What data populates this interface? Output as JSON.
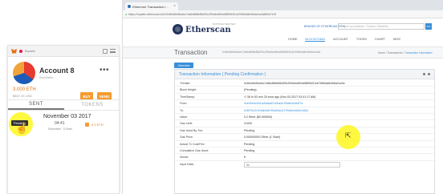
{
  "metamask": {
    "network": "Ropsten",
    "account_name": "Account 8",
    "account_address": "0xe00e0c...",
    "menu_dots": "•••",
    "balance_eth": "3.000 ETH",
    "balance_usd": "$867.03 USD",
    "buy_label": "BUY",
    "send_label": "SEND",
    "tabs": [
      {
        "label": "SENT",
        "active": true
      },
      {
        "label": "TOKENS",
        "active": false
      }
    ],
    "tx": {
      "date": "November 03 2017",
      "time": "04:41",
      "status": "Submitted · 5 Gwei",
      "amount": "0.2 ETH",
      "tooltip": "Pending"
    }
  },
  "browser": {
    "tab_title": "Ethereum Transaction I...",
    "address": "https://ropsten.etherscan.io/tx/0x5b3d0d9a4ec7a6bd66fe85d29c2f9c6ea9b4d58f0fe01cb7bf60a8e0b6a2cc0a8b0e7e3f",
    "secure_label": "Secure"
  },
  "etherscan": {
    "brand": "Etherscan",
    "brand_sub": "ROPSTEN TESTNET",
    "promo": "BRANDS OF ETHEREUM (ETH)",
    "search_placeholder": "Search by Address / Txhash / BlockNo",
    "search_go": "GO",
    "nav": [
      {
        "label": "HOME",
        "active": false
      },
      {
        "label": "BLOCKCHAIN",
        "active": true
      },
      {
        "label": "ACCOUNT",
        "active": false
      },
      {
        "label": "TOKEN",
        "active": false
      },
      {
        "label": "CHART",
        "active": false
      },
      {
        "label": "MISC",
        "active": false
      }
    ],
    "page_title": "Transaction",
    "page_hash": "0x5b3d0d9a4ec7a6bd66fe85d29c2f9c6ea9b4d58f0fe01cb7bf60a8e0b6a2cc0a",
    "breadcrumb": [
      "Home",
      "Transactions",
      "Transaction Information"
    ],
    "overview_tab": "Overview",
    "panel_title": "Transaction Information   ( Pending Confirmation )",
    "rows": [
      {
        "label": "TxHash:",
        "value": "0x5b3d0d9a4ec7a6bd66fe85d29c2f9c6ea9b4d58f0fe01cb7bf60a8e0b6a2cc0a",
        "link": false
      },
      {
        "label": "Block Height:",
        "value": "(Pending)",
        "link": false
      },
      {
        "label": "TimeStamp:",
        "value": "⏱ 38 hr 53 min 25 secs ago (Nov-03-2017 03:41:17 AM)",
        "link": false
      },
      {
        "label": "From:",
        "value": "0xe00e0c0b1ad3a6a67c0ba3e7f5a6c54d4f7a",
        "link": true
      },
      {
        "label": "To:",
        "value": "0x6f79c2c7b3ab4db7fba54ac317f0a5ce6d0c4d0d",
        "link": true
      },
      {
        "label": "Value:",
        "value": "0.2 Ether ($0.000000)",
        "link": false
      },
      {
        "label": "Gas Limit:",
        "value": "21000",
        "link": false
      },
      {
        "label": "Gas Used By Txn:",
        "value": "Pending",
        "link": false
      },
      {
        "label": "Gas Price:",
        "value": "0.000000001 Ether (1 Gwei)",
        "link": false
      },
      {
        "label": "Actual Tx Cost/Fee:",
        "value": "Pending",
        "link": false
      },
      {
        "label": "Cumulative Gas Used:",
        "value": "Pending",
        "link": false
      },
      {
        "label": "Nonce:",
        "value": "6",
        "link": false
      }
    ],
    "input_data_label": "Input Data:",
    "input_data_value": "0x"
  }
}
